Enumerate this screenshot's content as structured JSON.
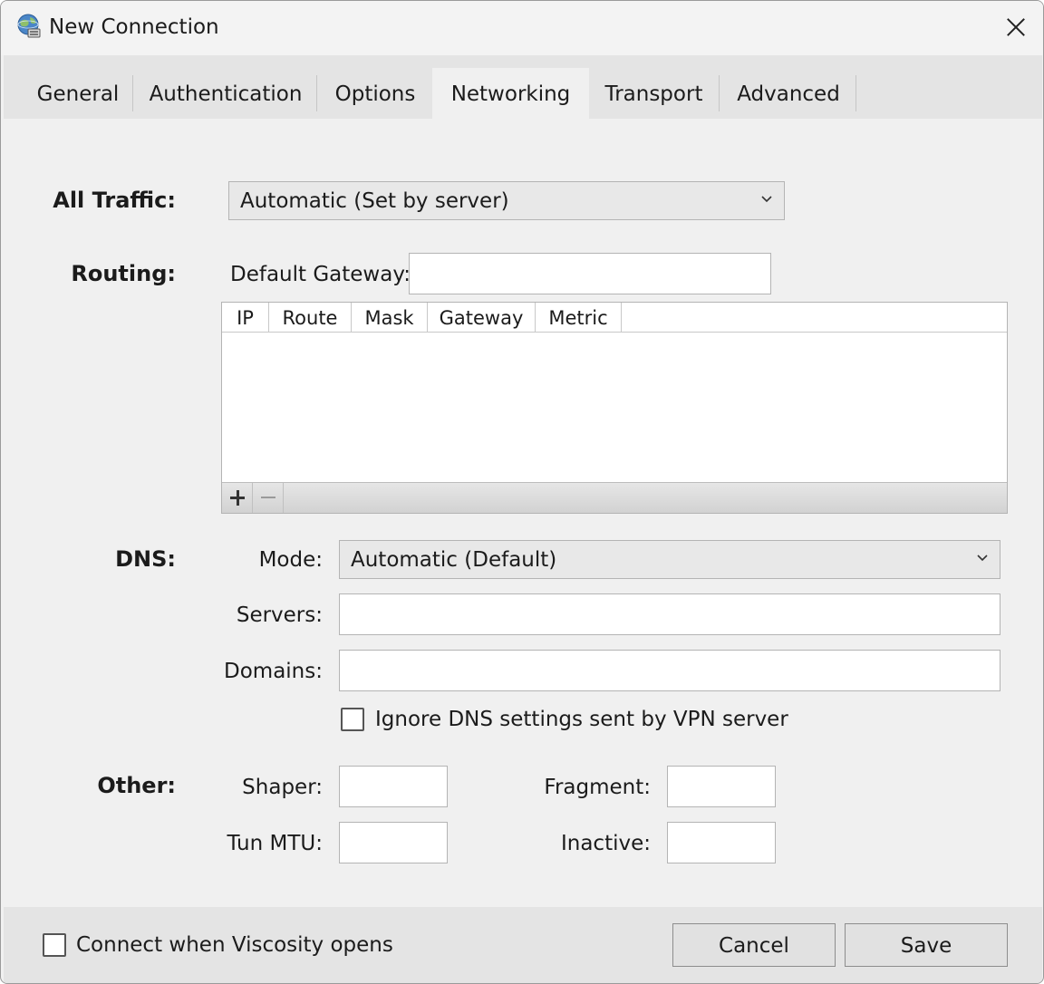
{
  "window": {
    "title": "New Connection",
    "icon": "globe-network-icon"
  },
  "tabs": [
    {
      "label": "General",
      "active": false
    },
    {
      "label": "Authentication",
      "active": false
    },
    {
      "label": "Options",
      "active": false
    },
    {
      "label": "Networking",
      "active": true
    },
    {
      "label": "Transport",
      "active": false
    },
    {
      "label": "Advanced",
      "active": false
    }
  ],
  "all_traffic": {
    "label": "All Traffic:",
    "value": "Automatic (Set by server)"
  },
  "routing": {
    "label": "Routing:",
    "default_gateway_label": "Default Gateway:",
    "default_gateway_value": "",
    "columns": [
      "IP",
      "Route",
      "Mask",
      "Gateway",
      "Metric"
    ],
    "rows": []
  },
  "dns": {
    "label": "DNS:",
    "mode_label": "Mode:",
    "mode_value": "Automatic (Default)",
    "servers_label": "Servers:",
    "servers_value": "",
    "domains_label": "Domains:",
    "domains_value": "",
    "ignore_label": "Ignore DNS settings sent by VPN server",
    "ignore_checked": false
  },
  "other": {
    "label": "Other:",
    "shaper_label": "Shaper:",
    "tun_mtu_label": "Tun MTU:",
    "fragment_label": "Fragment:",
    "inactive_label": "Inactive:"
  },
  "footer": {
    "connect_label": "Connect when Viscosity opens",
    "connect_checked": false,
    "cancel_label": "Cancel",
    "save_label": "Save"
  }
}
